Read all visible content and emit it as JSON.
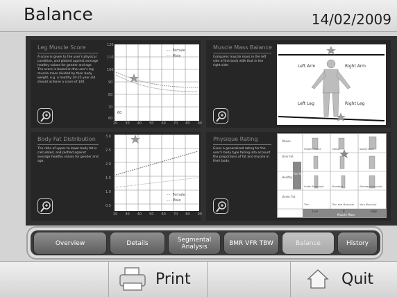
{
  "header": {
    "title": "Balance",
    "date": "14/02/2009"
  },
  "panels": {
    "leg": {
      "title": "Leg Muscle Score",
      "desc": "A score is given to the user's physical condition, and plotted against average healthy values for gender and age. The score is based on the user's leg muscle mass divided by their body weight, e.g. a healthy 20-25 year old should achieve a score of 100.",
      "yticks": [
        "120",
        "110",
        "100",
        "90",
        "80",
        "70",
        "60"
      ],
      "xticks": [
        "20",
        "30",
        "40",
        "50",
        "60",
        "70",
        "80",
        "90"
      ],
      "legend": [
        "Female",
        "Male"
      ],
      "inner_label": "60"
    },
    "muscle": {
      "title": "Muscle Mass Balance",
      "desc": "Compares muscle mass in the left side of the body with that in the right side.",
      "labels": {
        "left_arm": "Left Arm",
        "right_arm": "Right Arm",
        "left_leg": "Left Leg",
        "right_leg": "Right Leg"
      }
    },
    "fat": {
      "title": "Body Fat Distribution",
      "desc": "The ratio of upper to lower body fat is calculated, and plotted against average healthy values for gender and age.",
      "yticks": [
        "3.0",
        "2.5",
        "2.0",
        "1.5",
        "1.0",
        "0.5"
      ],
      "xticks": [
        "20",
        "30",
        "40",
        "50",
        "60",
        "70",
        "80",
        "90"
      ],
      "legend": [
        "Female",
        "Male"
      ]
    },
    "physique": {
      "title": "Physique Rating",
      "desc": "Gives a generalised rating for the user's body type taking into account the proportions of fat and muscle in their body.",
      "rows": [
        "Obese",
        "Over Fat",
        "Healthy",
        "Under Fat"
      ],
      "row_header": "Fat %",
      "cells": [
        "Hidden Obese",
        "Obese",
        "Solidly Built",
        "Under Exercised",
        "Standard",
        "Standard Muscular",
        "Thin",
        "Thin and Muscular",
        "Very Muscular"
      ],
      "xlabels": [
        "Low",
        "0",
        "High"
      ],
      "xaxis": "Muscle Mass"
    }
  },
  "tabs": [
    {
      "label": "Overview",
      "active": false
    },
    {
      "label": "Details",
      "active": false
    },
    {
      "label": "Segmental Analysis",
      "active": false
    },
    {
      "label": "BMR VFR TBW",
      "active": false
    },
    {
      "label": "Balance",
      "active": true
    },
    {
      "label": "History",
      "active": false
    }
  ],
  "buttons": {
    "print": "Print",
    "quit": "Quit"
  },
  "icons": {
    "print": "printer-icon",
    "quit": "home-icon",
    "zoom": "zoom-in-icon"
  }
}
